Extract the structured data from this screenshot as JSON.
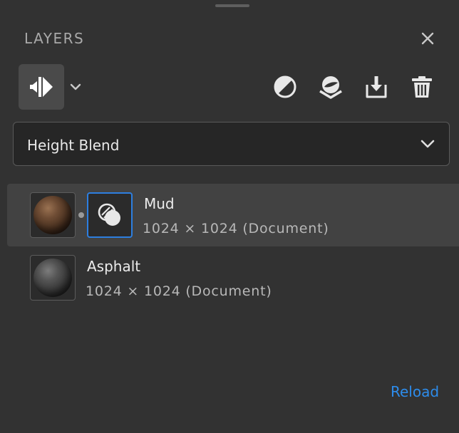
{
  "panel": {
    "title": "LAYERS",
    "close_icon": "close-icon"
  },
  "toolbar": {
    "main_tool_icon": "layer-stack-icon",
    "tools": [
      {
        "name": "fill-layer-button",
        "icon": "half-circle-icon"
      },
      {
        "name": "paint-layer-button",
        "icon": "paint-sphere-icon"
      },
      {
        "name": "import-button",
        "icon": "import-icon"
      },
      {
        "name": "delete-button",
        "icon": "trash-icon"
      }
    ]
  },
  "blend_mode": {
    "selected": "Height Blend"
  },
  "layers": [
    {
      "name": "Mud",
      "info": "1024 × 1024 (Document)",
      "selected": true,
      "has_mask": true
    },
    {
      "name": "Asphalt",
      "info": "1024 × 1024 (Document)",
      "selected": false,
      "has_mask": false
    }
  ],
  "footer": {
    "reload_label": "Reload"
  },
  "colors": {
    "background": "#323232",
    "accent": "#2d8ceb",
    "selected_row": "#424242",
    "mask_border": "#2d7fe0"
  }
}
